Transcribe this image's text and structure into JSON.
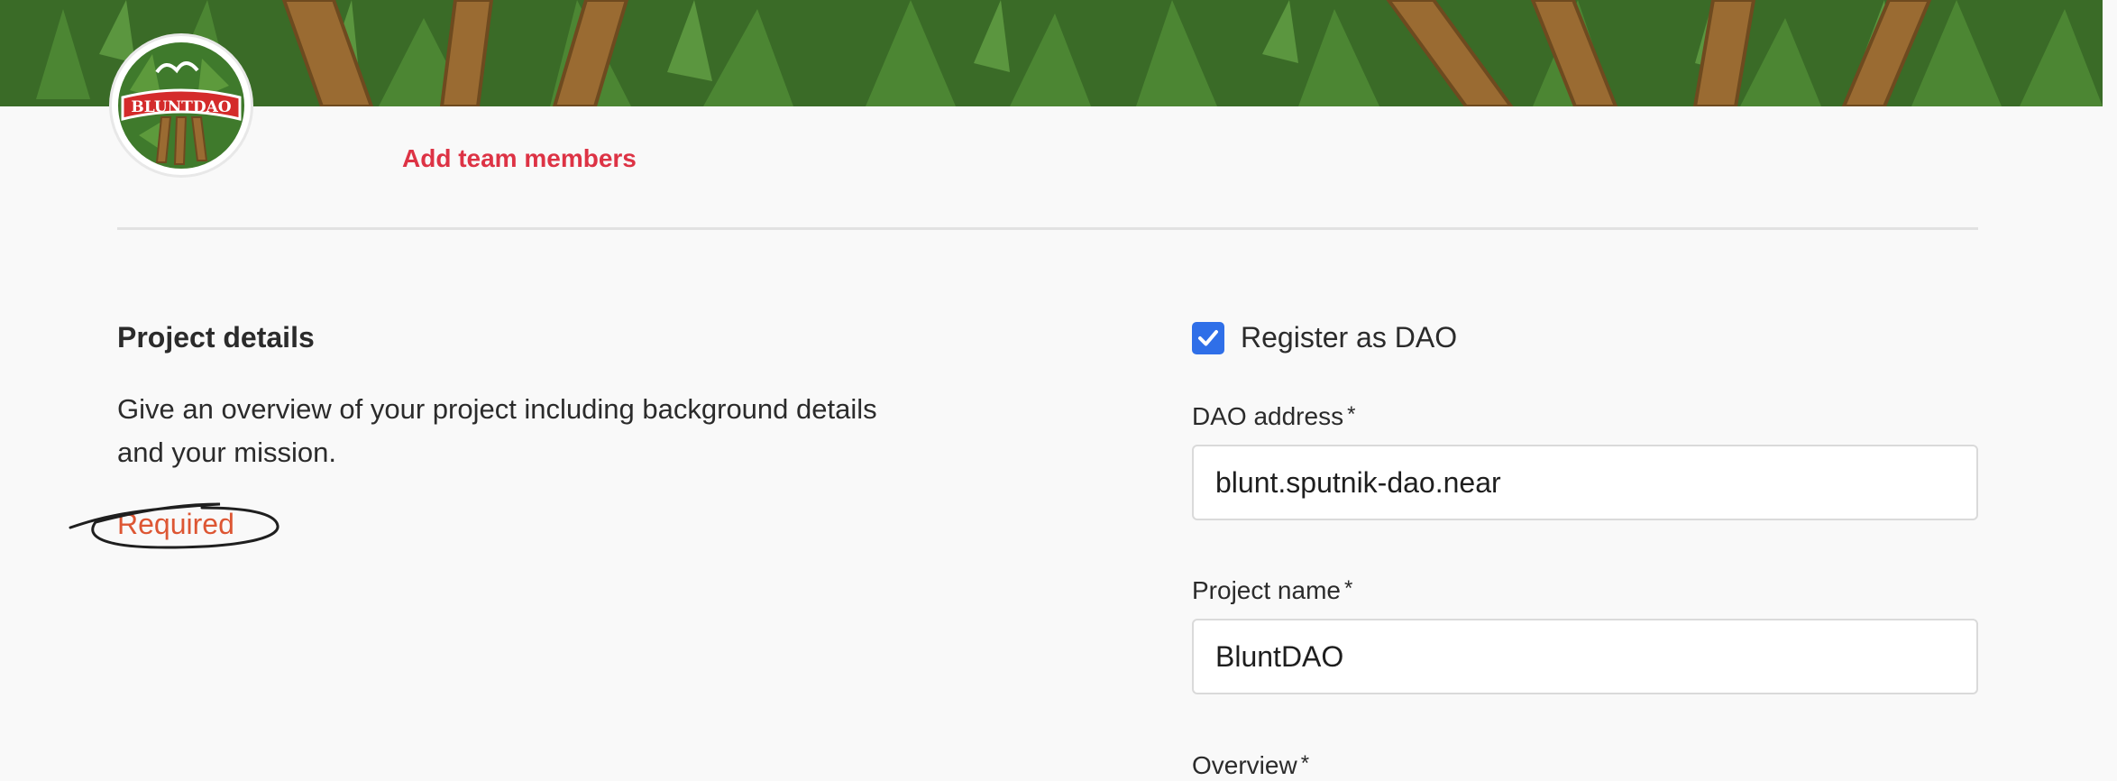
{
  "banner": {
    "image": "cannabis-leaves-and-blunts-banner"
  },
  "avatar": {
    "image": "bluntdao-logo",
    "logo_text": "BLUNTDAO"
  },
  "team": {
    "add_members_label": "Add team members"
  },
  "project_details": {
    "title": "Project details",
    "description": "Give an overview of your project including background details and your mission.",
    "required_text": "Required"
  },
  "form": {
    "register_dao": {
      "label": "Register as DAO",
      "checked": true
    },
    "dao_address": {
      "label": "DAO address",
      "required_mark": "*",
      "value": "blunt.sputnik-dao.near"
    },
    "project_name": {
      "label": "Project name",
      "required_mark": "*",
      "value": "BluntDAO"
    },
    "overview": {
      "label": "Overview",
      "required_mark": "*"
    }
  },
  "colors": {
    "accent": "#dd3345",
    "required": "#dd5633",
    "checkbox": "#2f6fe8",
    "background": "#f9f9f9"
  }
}
